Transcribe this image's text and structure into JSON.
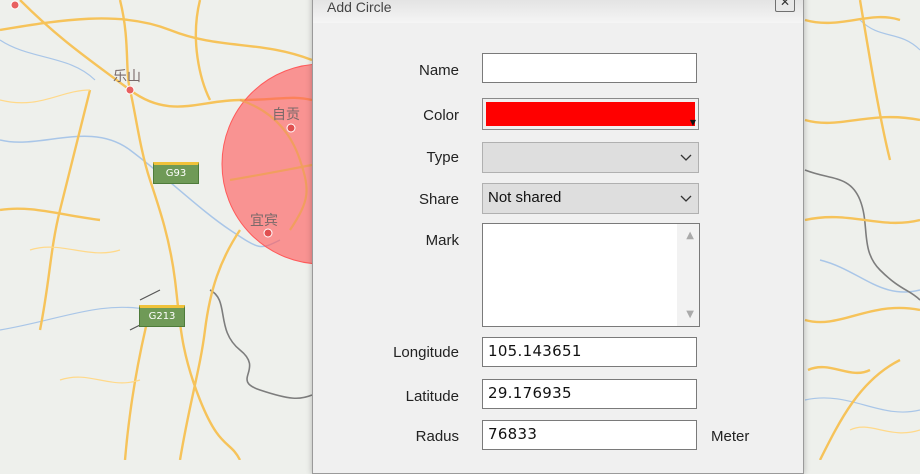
{
  "map": {
    "labels": {
      "leshan": "乐山",
      "zigong": "自贡",
      "yibin": "宜宾"
    },
    "shields": {
      "g93": "G93",
      "g213": "G213"
    },
    "circle_color": "#ff5a5a"
  },
  "dialog": {
    "title": "Add Circle",
    "close_glyph": "✕",
    "fields": {
      "name": {
        "label": "Name",
        "value": ""
      },
      "color": {
        "label": "Color",
        "value": "#ff0000"
      },
      "type": {
        "label": "Type",
        "value": ""
      },
      "share": {
        "label": "Share",
        "value": "Not shared"
      },
      "mark": {
        "label": "Mark",
        "value": ""
      },
      "longitude": {
        "label": "Longitude",
        "value": "105.143651"
      },
      "latitude": {
        "label": "Latitude",
        "value": "29.176935"
      },
      "radius": {
        "label": "Radus",
        "value": "76833",
        "unit": "Meter"
      }
    }
  }
}
